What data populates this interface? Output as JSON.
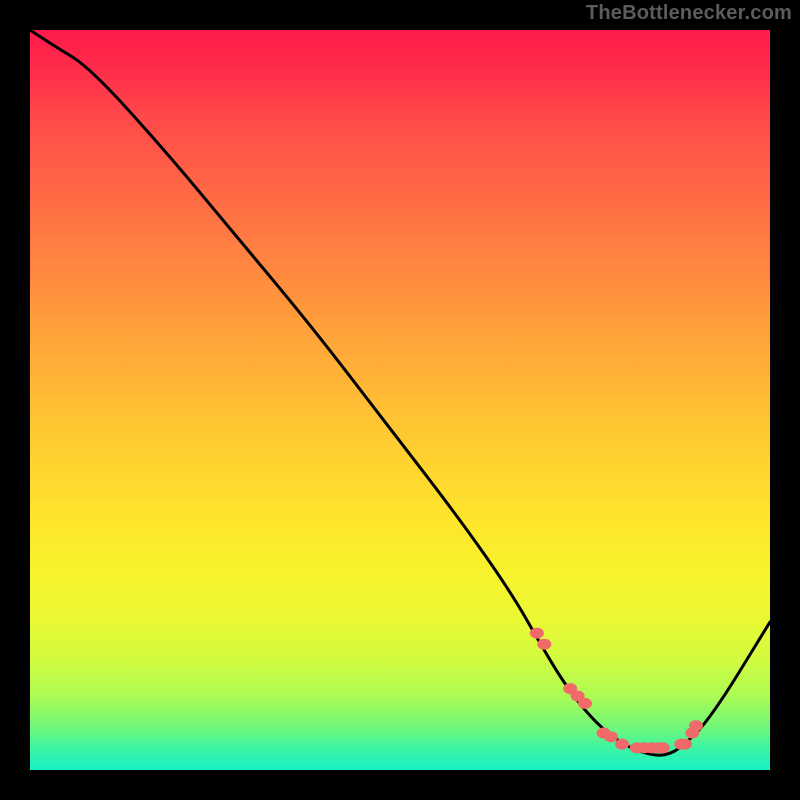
{
  "attribution": "TheBottlenecker.com",
  "chart_data": {
    "type": "line",
    "title": "",
    "xlabel": "",
    "ylabel": "",
    "xlim": [
      0,
      100
    ],
    "ylim": [
      0,
      100
    ],
    "series": [
      {
        "name": "bottleneck-curve",
        "x": [
          0,
          3,
          8,
          18,
          28,
          38,
          48,
          58,
          65,
          69,
          72,
          75,
          78,
          81,
          84,
          86,
          88,
          92,
          100
        ],
        "values": [
          100,
          98,
          95,
          84,
          72,
          60,
          47,
          34,
          24,
          17,
          12,
          8,
          5,
          3,
          2,
          2,
          3,
          7,
          20
        ]
      },
      {
        "name": "highlight-dots",
        "x": [
          68.5,
          69.5,
          73.0,
          74.0,
          75.0,
          77.5,
          78.5,
          80.0,
          82.0,
          83.0,
          84.0,
          85.0,
          85.5,
          88.0,
          88.5,
          89.5,
          90.0
        ],
        "values": [
          18.5,
          17.0,
          11.0,
          10.0,
          9.0,
          5.0,
          4.5,
          3.5,
          3.0,
          3.0,
          3.0,
          3.0,
          3.0,
          3.5,
          3.5,
          5.0,
          6.0
        ]
      }
    ],
    "gradient_stops": [
      {
        "pos": 0,
        "color": "#ff1a4b"
      },
      {
        "pos": 100,
        "color": "#18f0c8"
      }
    ],
    "highlight_color": "#f06a6a",
    "curve_color": "#000000"
  }
}
